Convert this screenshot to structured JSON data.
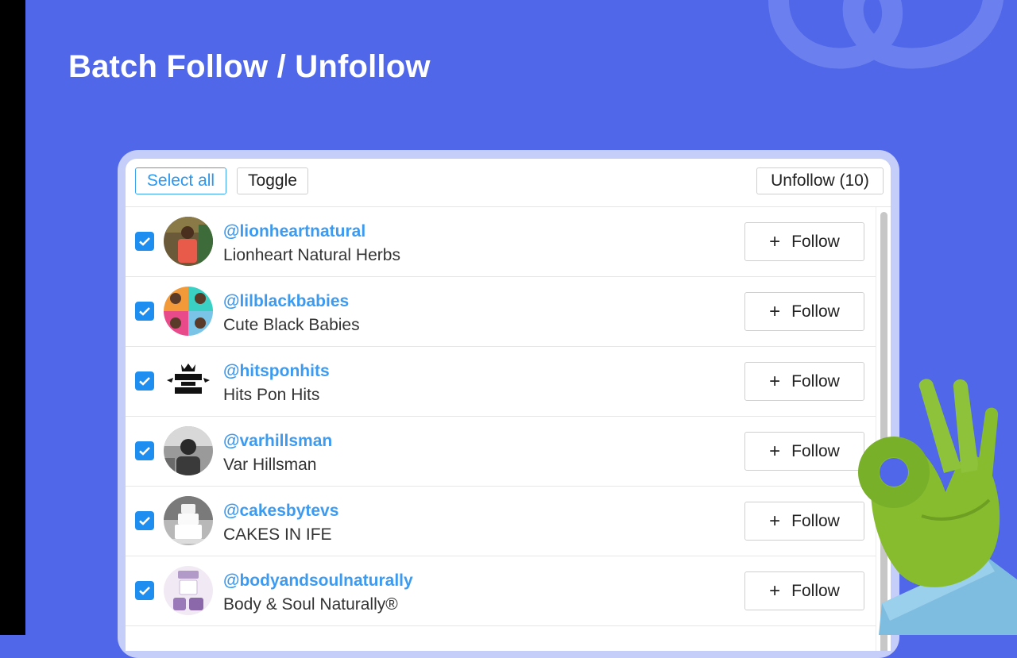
{
  "headline": "Batch Follow / Unfollow",
  "toolbar": {
    "select_all_label": "Select all",
    "toggle_label": "Toggle",
    "unfollow_label": "Unfollow (10)"
  },
  "follow_label": "Follow",
  "accounts": [
    {
      "handle": "@lionheartnatural",
      "name": "Lionheart Natural Herbs",
      "checked": true
    },
    {
      "handle": "@lilblackbabies",
      "name": "Cute Black Babies",
      "checked": true
    },
    {
      "handle": "@hitsponhits",
      "name": "Hits Pon Hits",
      "checked": true
    },
    {
      "handle": "@varhillsman",
      "name": "Var Hillsman",
      "checked": true
    },
    {
      "handle": "@cakesbytevs",
      "name": "CAKES IN IFE",
      "checked": true
    },
    {
      "handle": "@bodyandsoulnaturally",
      "name": "Body & Soul Naturally®",
      "checked": true
    }
  ],
  "colors": {
    "background": "#4f67e8",
    "accent_blue": "#1e8ff0",
    "handle_blue": "#3c9bf0"
  }
}
